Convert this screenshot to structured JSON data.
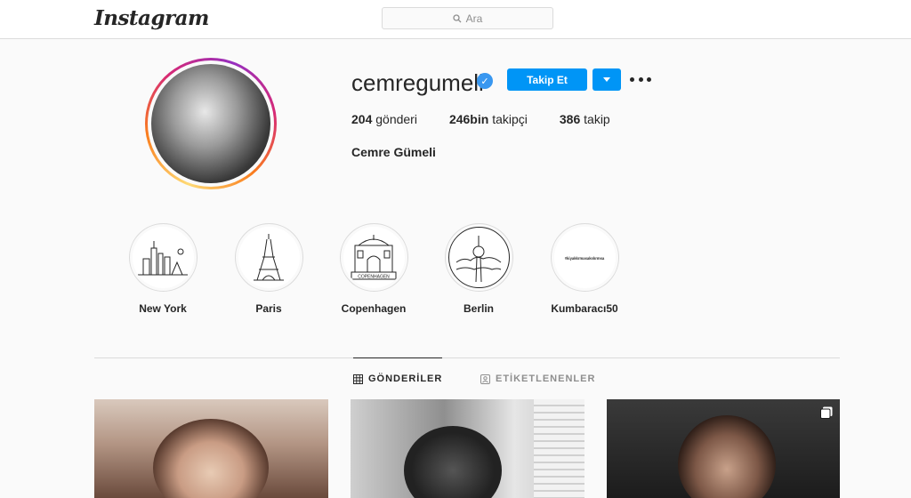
{
  "header": {
    "logo_text": "Instagram",
    "search_placeholder": "Ara"
  },
  "profile": {
    "username": "cemregumeli",
    "verified": true,
    "follow_label": "Takip Et",
    "stats": {
      "posts_count": "204",
      "posts_label": "gönderi",
      "followers_count": "246bin",
      "followers_label": "takipçi",
      "following_count": "386",
      "following_label": "takip"
    },
    "full_name": "Cemre Gümeli"
  },
  "highlights": [
    {
      "label": "New York",
      "icon": "new-york-skyline-icon"
    },
    {
      "label": "Paris",
      "icon": "eiffel-tower-icon"
    },
    {
      "label": "Copenhagen",
      "icon": "copenhagen-gate-icon",
      "badge_text": "COPENHAGEN"
    },
    {
      "label": "Berlin",
      "icon": "berlin-tv-tower-icon"
    },
    {
      "label": "Kumbaracı50",
      "icon": "text-badge-icon",
      "badge_text": "#kiyakkrmasakskrmsa"
    }
  ],
  "tabs": [
    {
      "label": "GÖNDERİLER",
      "icon": "grid-icon",
      "active": true
    },
    {
      "label": "ETİKETLENENLER",
      "icon": "tagged-icon",
      "active": false
    }
  ],
  "posts": [
    {
      "kind": "photo"
    },
    {
      "kind": "photo"
    },
    {
      "kind": "photo",
      "multi": true
    }
  ],
  "colors": {
    "accent": "#0095f6",
    "verified": "#3897f0",
    "text": "#262626",
    "muted": "#8e8e8e",
    "border": "#dbdbdb"
  }
}
